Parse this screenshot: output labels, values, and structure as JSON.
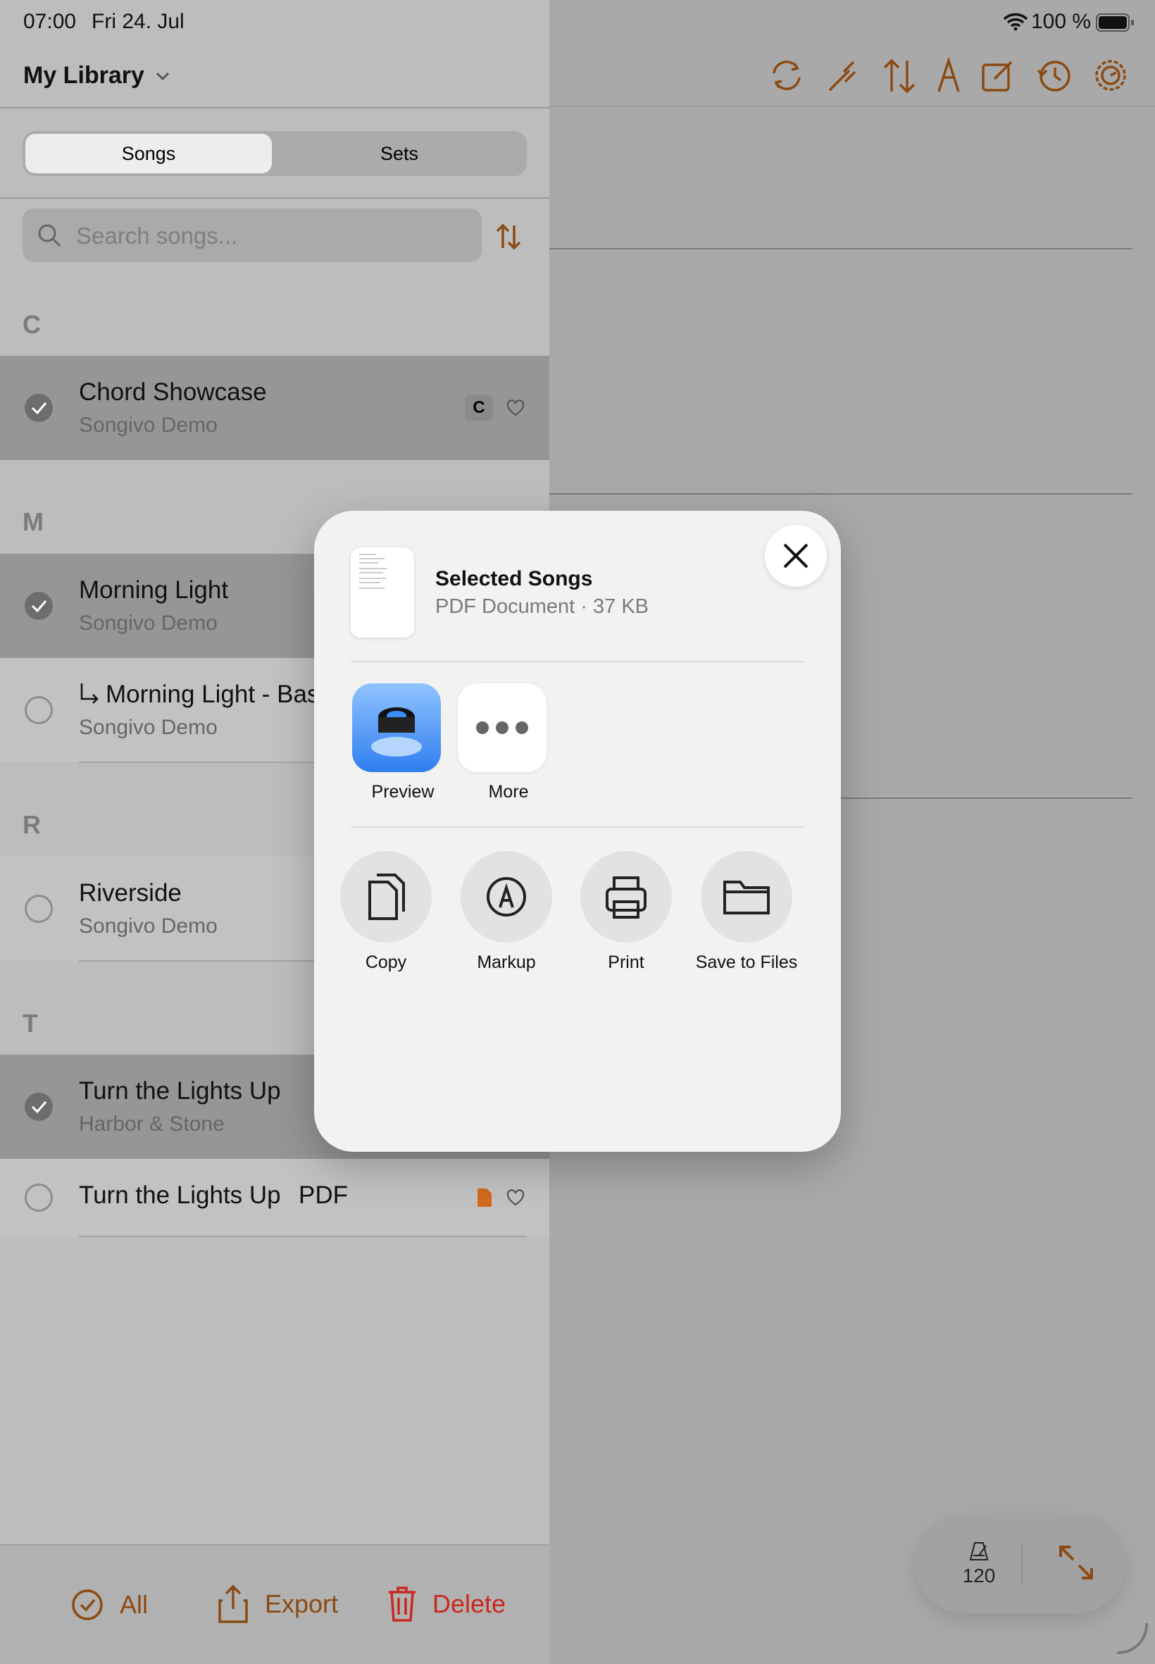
{
  "status_bar": {
    "time": "07:00",
    "date": "Fri 24. Jul",
    "battery": "100 %"
  },
  "sidebar": {
    "title": "My Library",
    "segments": {
      "songs": "Songs",
      "sets": "Sets"
    },
    "search": {
      "placeholder": "Search songs..."
    },
    "sections": [
      {
        "letter": "C"
      },
      {
        "letter": "M"
      },
      {
        "letter": "R"
      },
      {
        "letter": "T"
      }
    ],
    "rows": [
      {
        "title": "Chord Showcase",
        "subtitle": "Songivo Demo",
        "key_badge": "C",
        "selected": true
      },
      {
        "title": "Morning Light",
        "subtitle": "Songivo Demo",
        "selected": true
      },
      {
        "title": "Morning Light - Bas",
        "subtitle": "Songivo Demo",
        "selected": false
      },
      {
        "title": "Riverside",
        "subtitle": "Songivo Demo",
        "selected": false
      },
      {
        "title": "Turn the Lights Up",
        "subtitle": "Harbor & Stone",
        "selected": true
      },
      {
        "title": "Turn the Lights Up",
        "pdf_tag": "PDF",
        "selected": false
      }
    ]
  },
  "bottom_bar": {
    "all": "All",
    "export": "Export",
    "delete": "Delete"
  },
  "share_sheet": {
    "doc_title": "Selected Songs",
    "doc_meta": "PDF Document · 37 KB",
    "apps": [
      {
        "label": "Preview"
      },
      {
        "label": "More"
      }
    ],
    "actions": [
      {
        "label": "Copy"
      },
      {
        "label": "Markup"
      },
      {
        "label": "Print"
      },
      {
        "label": "Save to Files"
      }
    ]
  },
  "float_controls": {
    "tempo": "120"
  },
  "colors": {
    "accent": "#8b4a12",
    "delete": "#c8281e",
    "pdf": "#d26b1a"
  }
}
